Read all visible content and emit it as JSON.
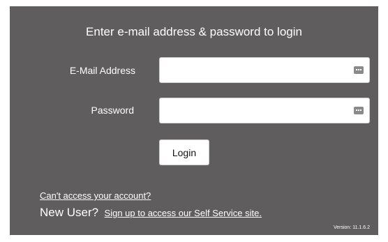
{
  "login": {
    "heading": "Enter e-mail address & password to login",
    "email_label": "E-Mail Address",
    "email_value": "",
    "password_label": "Password",
    "password_value": "",
    "login_button": "Login",
    "password_manager_icon": "password-manager-icon"
  },
  "footer": {
    "cant_access_link": "Can't access your account?",
    "new_user_label": "New User?",
    "signup_link": "Sign up to access our Self Service site.",
    "version": "Version: 11.1.6.2"
  },
  "colors": {
    "panel_background": "#5f5d5d",
    "text": "#ffffff",
    "field_background": "#ffffff"
  }
}
